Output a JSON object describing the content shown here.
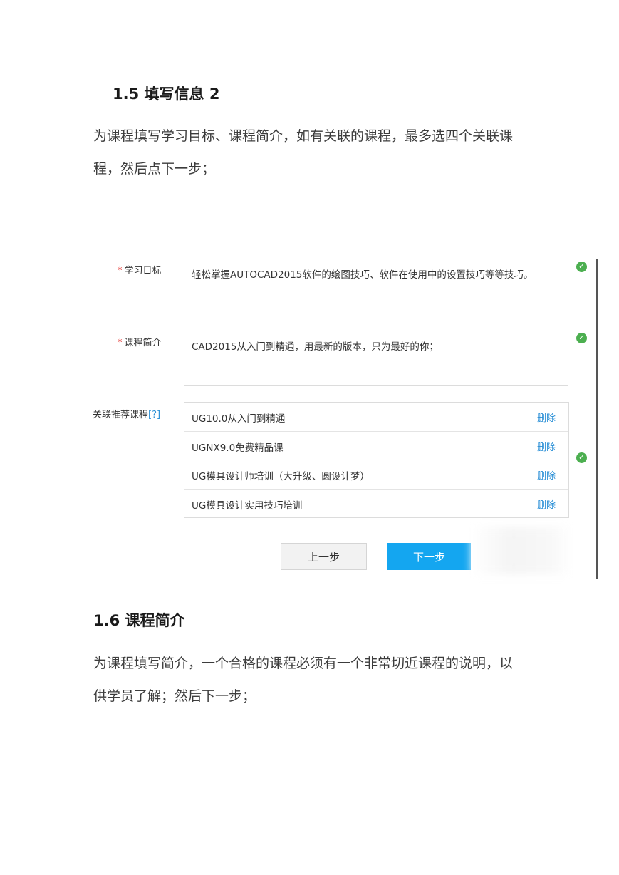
{
  "section1": {
    "heading": "1.5  填写信息 2",
    "paragraph_line1": "为课程填写学习目标、课程简介，如有关联的课程，最多选四个关联课",
    "paragraph_line2": "程，然后点下一步；"
  },
  "form": {
    "learning_goal": {
      "required_mark": "*",
      "label": "学习目标",
      "value": "轻松掌握AUTOCAD2015软件的绘图技巧、软件在使用中的设置技巧等等技巧。"
    },
    "course_intro": {
      "required_mark": "*",
      "label": "课程简介",
      "value": "CAD2015从入门到精通，用最新的版本，只为最好的你；"
    },
    "related_courses": {
      "label": "关联推荐课程",
      "help": "[?]",
      "delete_label": "删除",
      "items": [
        "UG10.0从入门到精通",
        "UGNX9.0免费精品课",
        "UG模具设计师培训（大升级、圆设计梦）",
        "UG模具设计实用技巧培训"
      ]
    },
    "prev_button": "上一步",
    "next_button": "下一步",
    "status_color": "#4caf50",
    "accent_color": "#14a6f0"
  },
  "section2": {
    "heading": "1.6  课程简介",
    "paragraph_line1": "为课程填写简介，一个合格的课程必须有一个非常切近课程的说明，以",
    "paragraph_line2": "供学员了解；然后下一步；"
  }
}
